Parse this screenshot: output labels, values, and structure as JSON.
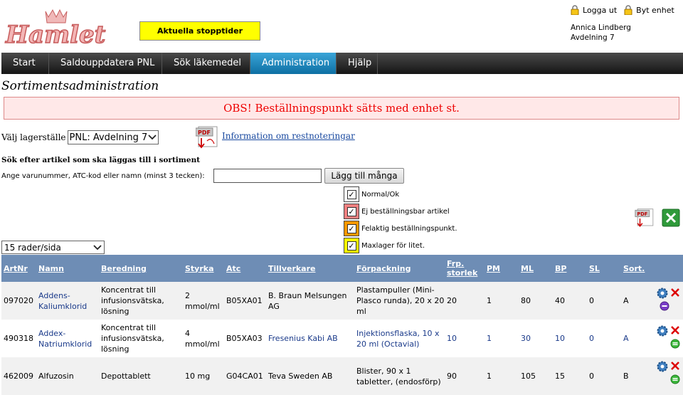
{
  "header": {
    "logo_text": "Hamlet",
    "stop_button": "Aktuella stopptider",
    "logout": "Logga ut",
    "change_unit": "Byt enhet",
    "user_name": "Annica Lindberg",
    "user_unit": "Avdelning 7"
  },
  "nav": {
    "items": [
      {
        "label": "Start",
        "active": false
      },
      {
        "label": "Saldouppdatera PNL",
        "active": false
      },
      {
        "label": "Sök läkemedel",
        "active": false
      },
      {
        "label": "Administration",
        "active": true
      },
      {
        "label": "Hjälp",
        "active": false
      }
    ]
  },
  "page": {
    "title": "Sortimentsadministration",
    "alert": "OBS! Beställningspunkt sätts med enhet st.",
    "store_label": "Välj lagerställe",
    "store_value": "PNL: Avdelning 7",
    "restnote_link": "Information om restnoteringar",
    "search_heading": "Sök efter artikel som ska läggas till i sortiment",
    "search_label": "Ange varunummer, ATC-kod eller namn (minst 3 tecken):",
    "search_value": "",
    "add_many": "Lägg till många",
    "rows_per_page": "15 rader/sida"
  },
  "legend": [
    {
      "label": "Normal/Ok",
      "color": "#ffffff",
      "checked": true
    },
    {
      "label": "Ej beställningsbar artikel",
      "color": "#f08080",
      "checked": true
    },
    {
      "label": "Felaktig beställningspunkt.",
      "color": "#ff9900",
      "checked": true
    },
    {
      "label": "Maxlager för litet.",
      "color": "#ffff00",
      "checked": true
    }
  ],
  "table": {
    "headers": [
      "ArtNr",
      "Namn",
      "Beredning",
      "Styrka",
      "Atc",
      "Tillverkare",
      "Förpackning",
      "Frp. storlek",
      "PM",
      "ML",
      "BP",
      "SL",
      "Sort."
    ],
    "rows": [
      {
        "artnr": "097020",
        "namn": "Addens-Kaliumklorid",
        "beredning": "Koncentrat till infusionsvätska, lösning",
        "styrka": "2 mmol/ml",
        "atc": "B05XA01",
        "tillverkare": "B. Braun Melsungen AG",
        "forpackning": "Plastampuller (Mini-Plasco runda), 20 x 20 ml",
        "frp": "20",
        "pm": "1",
        "ml": "80",
        "bp": "40",
        "sl": "0",
        "sort": "A",
        "status_icon": "purple-circle-icon"
      },
      {
        "artnr": "490318",
        "namn": "Addex-Natriumklorid",
        "beredning": "Koncentrat till infusionsvätska, lösning",
        "styrka": "4 mmol/ml",
        "atc": "B05XA03",
        "tillverkare": "Fresenius Kabi AB",
        "forpackning": "Injektionsflaska, 10 x 20 ml (Octavial)",
        "frp": "10",
        "pm": "1",
        "ml": "30",
        "bp": "10",
        "sl": "0",
        "sort": "A",
        "status_icon": "green-circle-icon"
      },
      {
        "artnr": "462009",
        "namn": "Alfuzosin",
        "beredning": "Depottablett",
        "styrka": "10 mg",
        "atc": "G04CA01",
        "tillverkare": "Teva Sweden AB",
        "forpackning": "Blister, 90 x 1 tabletter, (endosförp)",
        "frp": "90",
        "pm": "1",
        "ml": "105",
        "bp": "15",
        "sl": "0",
        "sort": "B",
        "status_icon": "green-circle-icon"
      }
    ]
  }
}
